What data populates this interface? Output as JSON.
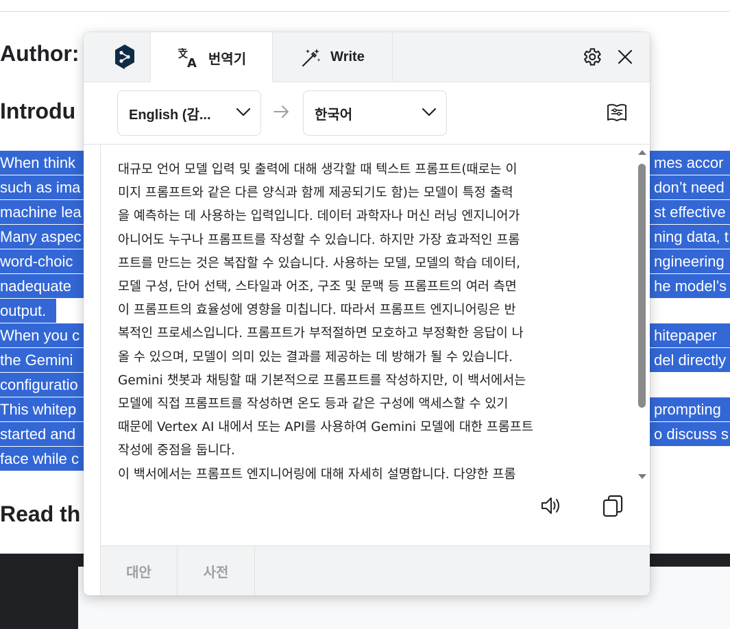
{
  "background_page": {
    "headings": [
      "Author:",
      "Introdu",
      "Read th"
    ],
    "highlighted_lines_left": [
      "When think",
      "such as ima",
      "machine lea",
      "Many aspec",
      "word-choic",
      "nadequate",
      "output.",
      "When you c",
      "the Gemini",
      "configuratio",
      "This whitep",
      "started and",
      "face while c"
    ],
    "highlighted_lines_right": [
      "mes accor",
      "don’t need",
      "st effective",
      "ning data, t",
      "ngineering",
      "he model’s",
      "hitepaper",
      "del directly",
      "prompting",
      "o discuss s"
    ]
  },
  "popup": {
    "tabs": {
      "translate": "번역기",
      "write": "Write"
    },
    "icons": {
      "logo": "deepl-logo-icon",
      "gear": "gear-icon",
      "close": "close-icon"
    },
    "source_language": "English (감...",
    "target_language": "한국어",
    "translation_text": "대규모 언어 모델 입력 및 출력에 대해 생각할 때 텍스트 프롬프트(때로는 이\n미지 프롬프트와 같은 다른 양식과 함께 제공되기도 함)는 모델이 특정 출력\n을 예측하는 데 사용하는 입력입니다. 데이터 과학자나 머신 러닝 엔지니어가\n아니어도 누구나 프롬프트를 작성할 수 있습니다. 하지만 가장 효과적인 프롬\n프트를 만드는 것은 복잡할 수 있습니다. 사용하는 모델, 모델의 학습 데이터,\n모델 구성, 단어 선택, 스타일과 어조, 구조 및 문맥 등 프롬프트의 여러 측면\n이 프롬프트의 효율성에 영향을 미칩니다. 따라서 프롬프트 엔지니어링은 반\n복적인 프로세스입니다. 프롬프트가 부적절하면 모호하고 부정확한 응답이 나\n올 수 있으며, 모델이 의미 있는 결과를 제공하는 데 방해가 될 수 있습니다.\nGemini 챗봇과 채팅할 때 기본적으로 프롬프트를 작성하지만, 이 백서에서는\n모델에 직접 프롬프트를 작성하면 온도 등과 같은 구성에 액세스할 수 있기\n때문에 Vertex AI 내에서 또는 API를 사용하여 Gemini 모델에 대한 프롬프트\n작성에 중점을 둡니다.\n이 백서에서는 프롬프트 엔지니어링에 대해 자세히 설명합니다. 다양한 프롬",
    "footer_tabs": {
      "alternatives": "대안",
      "dictionary": "사전"
    },
    "colors": {
      "accent": "#3367d6",
      "logo_bg": "#0f2b46",
      "muted": "#9aa0a6"
    }
  }
}
